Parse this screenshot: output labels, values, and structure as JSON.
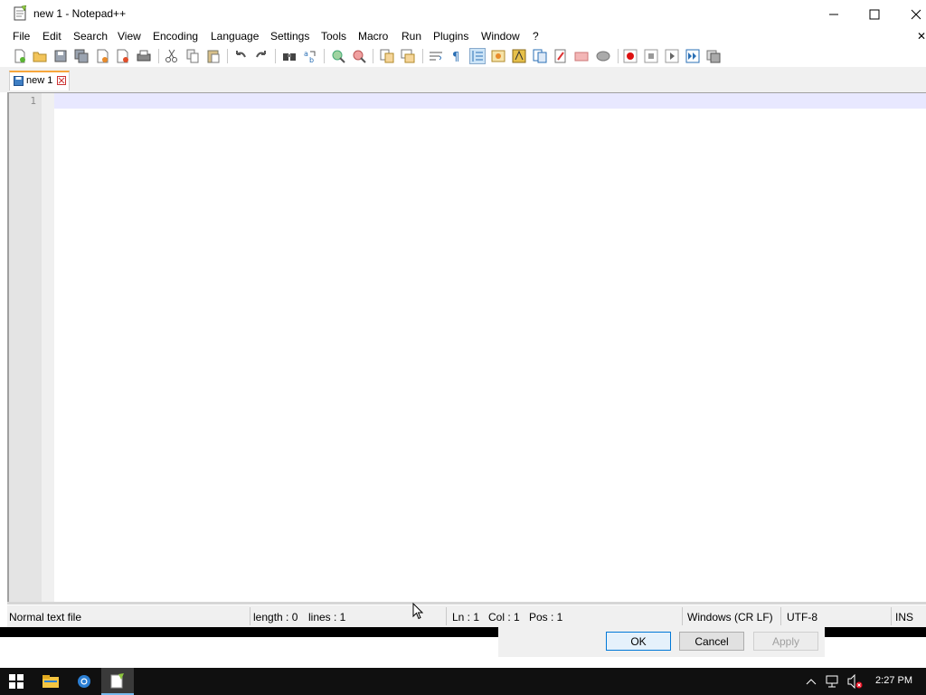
{
  "window": {
    "title": "new 1 - Notepad++",
    "controls": [
      "minimize",
      "maximize",
      "close"
    ]
  },
  "menu": {
    "items": [
      "File",
      "Edit",
      "Search",
      "View",
      "Encoding",
      "Language",
      "Settings",
      "Tools",
      "Macro",
      "Run",
      "Plugins",
      "Window",
      "?"
    ],
    "close_x": "✕"
  },
  "toolbar": {
    "icons": [
      "new-file-icon",
      "open-file-icon",
      "save-icon",
      "save-all-icon",
      "close-icon",
      "close-all-icon",
      "print-icon",
      "cut-icon",
      "copy-icon",
      "paste-icon",
      "undo-icon",
      "redo-icon",
      "find-icon",
      "replace-icon",
      "zoom-in-icon",
      "zoom-out-icon",
      "sync-vertical-icon",
      "sync-horizontal-icon",
      "word-wrap-icon",
      "show-all-chars-icon",
      "indent-guide-icon",
      "language-udl-icon",
      "document-map-icon",
      "function-list-icon",
      "folder-workspace-icon",
      "monitoring-icon",
      "record-macro-icon",
      "stop-record-icon",
      "playback-icon",
      "run-macro-multiple-icon",
      "save-macro-icon"
    ]
  },
  "tabs": [
    {
      "label": "new 1"
    }
  ],
  "editor": {
    "line_numbers": [
      "1"
    ],
    "content": ""
  },
  "status": {
    "file_type": "Normal text file",
    "length": "length : 0",
    "lines": "lines : 1",
    "ln": "Ln : 1",
    "col": "Col : 1",
    "pos": "Pos : 1",
    "eol": "Windows (CR LF)",
    "encoding": "UTF-8",
    "mode": "INS"
  },
  "dialog": {
    "ok": "OK",
    "cancel": "Cancel",
    "apply": "Apply"
  },
  "taskbar": {
    "clock": "2:27 PM"
  },
  "colors": {
    "current_line": "#e8e8ff",
    "tab_accent": "#f7a63b",
    "taskbar": "#101010"
  }
}
